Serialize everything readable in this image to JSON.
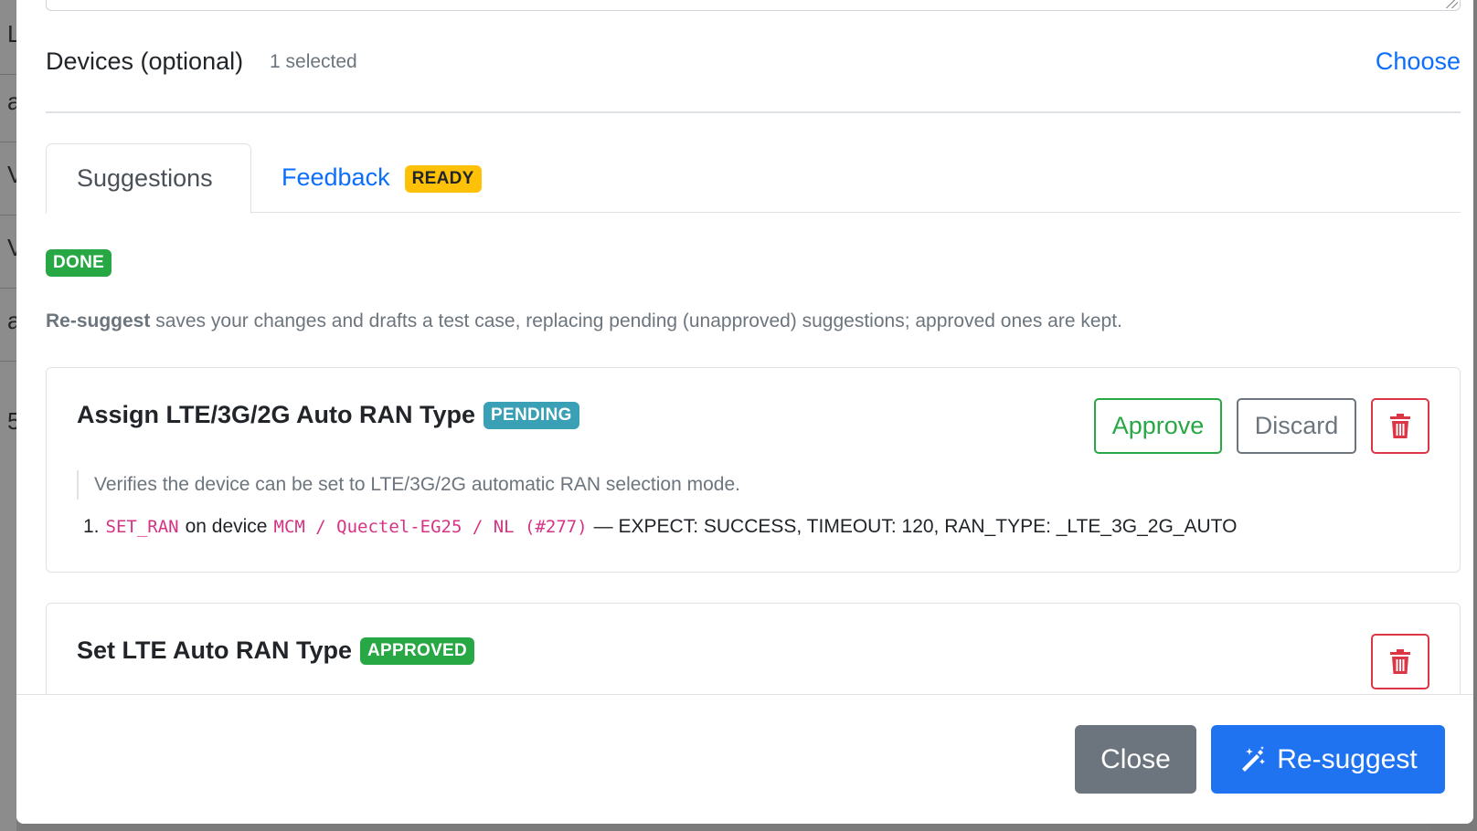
{
  "backdrop": {
    "rows": [
      "L",
      "ar",
      "V",
      "V",
      "ar",
      "5"
    ]
  },
  "devices": {
    "label": "Devices (optional)",
    "selected_count": "1 selected",
    "choose_label": "Choose"
  },
  "tabs": [
    {
      "label": "Suggestions",
      "active": true
    },
    {
      "label": "Feedback",
      "badge": "READY"
    }
  ],
  "status_badge": "DONE",
  "help": {
    "bold": "Re-suggest",
    "text": " saves your changes and drafts a test case, replacing pending (unapproved) suggestions; approved ones are kept."
  },
  "suggestions": [
    {
      "title": "Assign LTE/3G/2G Auto RAN Type",
      "status": "PENDING",
      "approve_label": "Approve",
      "discard_label": "Discard",
      "description": "Verifies the device can be set to LTE/3G/2G automatic RAN selection mode.",
      "steps": [
        {
          "number": "1.",
          "action": "SET_RAN",
          "on_device_text": "on device",
          "device": "MCM / Quectel-EG25 / NL (#277)",
          "params": "— EXPECT: SUCCESS, TIMEOUT: 120, RAN_TYPE: _LTE_3G_2G_AUTO"
        }
      ]
    },
    {
      "title": "Set LTE Auto RAN Type",
      "status": "APPROVED"
    }
  ],
  "footer": {
    "close_label": "Close",
    "resuggest_label": "Re-suggest"
  },
  "colors": {
    "primary": "#0d6efd",
    "success": "#28a745",
    "danger": "#dc3545",
    "secondary": "#6c757d",
    "warning": "#ffc107",
    "info": "#3aa0b6"
  }
}
